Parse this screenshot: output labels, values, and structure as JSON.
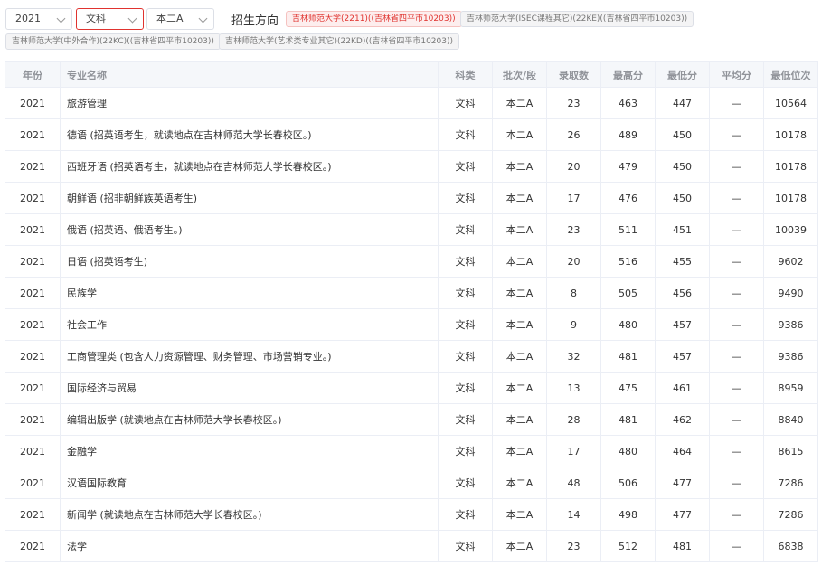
{
  "filters": {
    "year": "2021",
    "subject": "文科",
    "batch": "本二A",
    "direction_label": "招生方向",
    "tags": [
      "吉林师范大学(2211)((吉林省四平市10203))",
      "吉林师范大学(ISEC课程其它)(22KE)((吉林省四平市10203))",
      "吉林师范大学(中外合作)(22KC)((吉林省四平市10203))",
      "吉林师范大学(艺术类专业其它)(22KD)((吉林省四平市10203))"
    ]
  },
  "table": {
    "headers": [
      "年份",
      "专业名称",
      "科类",
      "批次/段",
      "录取数",
      "最高分",
      "最低分",
      "平均分",
      "最低位次"
    ],
    "rows": [
      {
        "year": "2021",
        "name": "旅游管理",
        "type": "文科",
        "batch": "本二A",
        "count": "23",
        "max": "463",
        "min": "447",
        "avg": "—",
        "rank": "10564"
      },
      {
        "year": "2021",
        "name": "德语 (招英语考生，就读地点在吉林师范大学长春校区。)",
        "type": "文科",
        "batch": "本二A",
        "count": "26",
        "max": "489",
        "min": "450",
        "avg": "—",
        "rank": "10178"
      },
      {
        "year": "2021",
        "name": "西班牙语 (招英语考生，就读地点在吉林师范大学长春校区。)",
        "type": "文科",
        "batch": "本二A",
        "count": "20",
        "max": "479",
        "min": "450",
        "avg": "—",
        "rank": "10178"
      },
      {
        "year": "2021",
        "name": "朝鲜语 (招非朝鲜族英语考生)",
        "type": "文科",
        "batch": "本二A",
        "count": "17",
        "max": "476",
        "min": "450",
        "avg": "—",
        "rank": "10178"
      },
      {
        "year": "2021",
        "name": "俄语 (招英语、俄语考生。)",
        "type": "文科",
        "batch": "本二A",
        "count": "23",
        "max": "511",
        "min": "451",
        "avg": "—",
        "rank": "10039"
      },
      {
        "year": "2021",
        "name": "日语 (招英语考生)",
        "type": "文科",
        "batch": "本二A",
        "count": "20",
        "max": "516",
        "min": "455",
        "avg": "—",
        "rank": "9602"
      },
      {
        "year": "2021",
        "name": "民族学",
        "type": "文科",
        "batch": "本二A",
        "count": "8",
        "max": "505",
        "min": "456",
        "avg": "—",
        "rank": "9490"
      },
      {
        "year": "2021",
        "name": "社会工作",
        "type": "文科",
        "batch": "本二A",
        "count": "9",
        "max": "480",
        "min": "457",
        "avg": "—",
        "rank": "9386"
      },
      {
        "year": "2021",
        "name": "工商管理类 (包含人力资源管理、财务管理、市场营销专业。)",
        "type": "文科",
        "batch": "本二A",
        "count": "32",
        "max": "481",
        "min": "457",
        "avg": "—",
        "rank": "9386"
      },
      {
        "year": "2021",
        "name": "国际经济与贸易",
        "type": "文科",
        "batch": "本二A",
        "count": "13",
        "max": "475",
        "min": "461",
        "avg": "—",
        "rank": "8959"
      },
      {
        "year": "2021",
        "name": "编辑出版学 (就读地点在吉林师范大学长春校区。)",
        "type": "文科",
        "batch": "本二A",
        "count": "28",
        "max": "481",
        "min": "462",
        "avg": "—",
        "rank": "8840"
      },
      {
        "year": "2021",
        "name": "金融学",
        "type": "文科",
        "batch": "本二A",
        "count": "17",
        "max": "480",
        "min": "464",
        "avg": "—",
        "rank": "8615"
      },
      {
        "year": "2021",
        "name": "汉语国际教育",
        "type": "文科",
        "batch": "本二A",
        "count": "48",
        "max": "506",
        "min": "477",
        "avg": "—",
        "rank": "7286"
      },
      {
        "year": "2021",
        "name": "新闻学 (就读地点在吉林师范大学长春校区。)",
        "type": "文科",
        "batch": "本二A",
        "count": "14",
        "max": "498",
        "min": "477",
        "avg": "—",
        "rank": "7286"
      },
      {
        "year": "2021",
        "name": "法学",
        "type": "文科",
        "batch": "本二A",
        "count": "23",
        "max": "512",
        "min": "481",
        "avg": "—",
        "rank": "6838"
      }
    ]
  }
}
